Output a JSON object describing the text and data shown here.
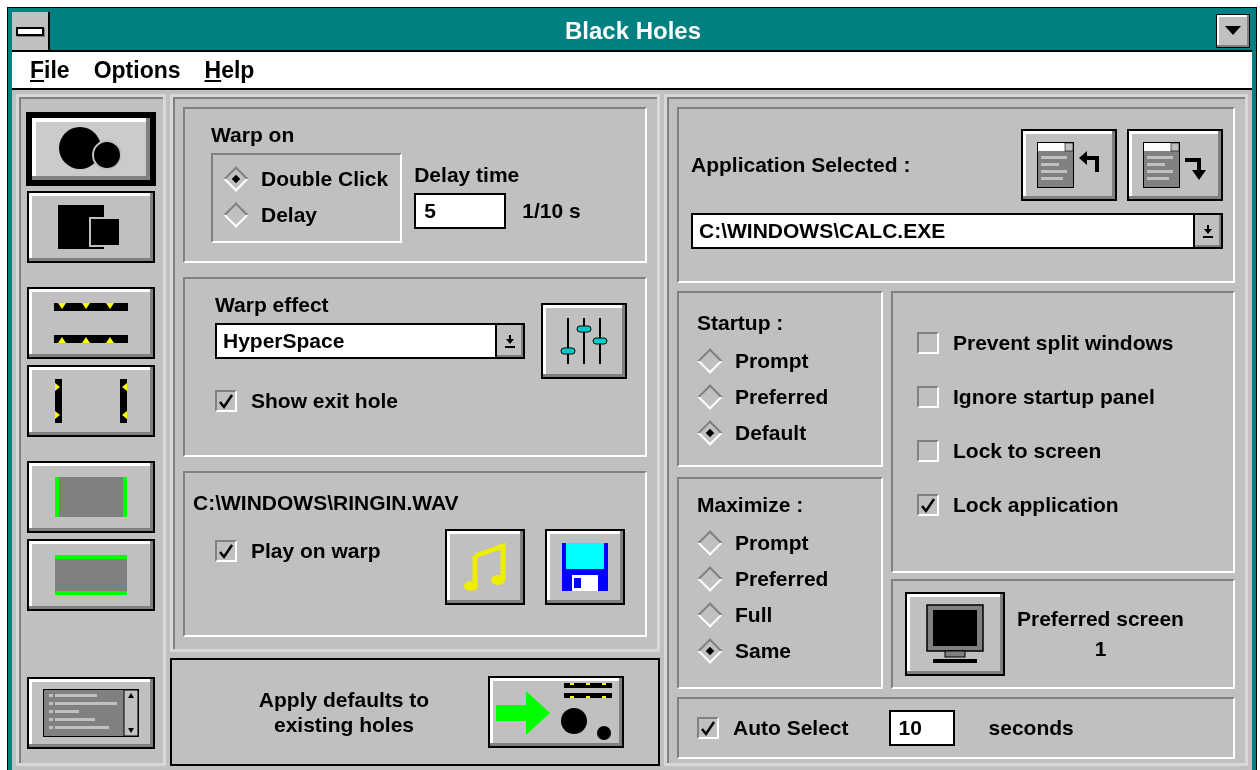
{
  "window": {
    "title": "Black Holes"
  },
  "menu": [
    {
      "underlined": "F",
      "text": "ile"
    },
    {
      "text": "Options"
    },
    {
      "underlined": "H",
      "text": "elp"
    }
  ],
  "toolbar": [
    {
      "kind": "circles",
      "selected": true
    },
    {
      "kind": "squares",
      "selected": false
    },
    {
      "kind": "horizontal-edges",
      "selected": false
    },
    {
      "kind": "vertical-edges",
      "selected": false
    },
    {
      "kind": "side-bars",
      "selected": false
    },
    {
      "kind": "top-bottom-bars",
      "selected": false
    }
  ],
  "warp_on": {
    "title": "Warp on",
    "options": [
      {
        "label": "Double Click",
        "selected": true
      },
      {
        "label": "Delay",
        "selected": false
      }
    ],
    "delay_label": "Delay time",
    "delay_value": "5",
    "delay_unit": "1/10 s"
  },
  "warp_effect": {
    "title": "Warp effect",
    "value": "HyperSpace",
    "show_exit_hole": {
      "label": "Show exit hole",
      "checked": true
    }
  },
  "sound": {
    "file": "C:\\WINDOWS\\RINGIN.WAV",
    "play_on_warp": {
      "label": "Play on warp",
      "checked": true
    }
  },
  "apply": {
    "lines": [
      "Apply defaults to",
      "existing holes"
    ]
  },
  "application": {
    "label": "Application Selected :",
    "value": "C:\\WINDOWS\\CALC.EXE"
  },
  "startup": {
    "title": "Startup :",
    "options": [
      {
        "label": "Prompt",
        "selected": false
      },
      {
        "label": "Preferred",
        "selected": false
      },
      {
        "label": "Default",
        "selected": true
      }
    ]
  },
  "maximize": {
    "title": "Maximize :",
    "options": [
      {
        "label": "Prompt",
        "selected": false
      },
      {
        "label": "Preferred",
        "selected": false
      },
      {
        "label": "Full",
        "selected": false
      },
      {
        "label": "Same",
        "selected": true
      }
    ]
  },
  "checks": [
    {
      "label": "Prevent split windows",
      "checked": false
    },
    {
      "label": "Ignore startup panel",
      "checked": false
    },
    {
      "label": "Lock to screen",
      "checked": false
    },
    {
      "label": "Lock application",
      "checked": true
    }
  ],
  "preferred_screen": {
    "label": "Preferred screen",
    "value": "1"
  },
  "auto_select": {
    "label": "Auto Select",
    "checked": true,
    "value": "10",
    "unit": "seconds"
  }
}
